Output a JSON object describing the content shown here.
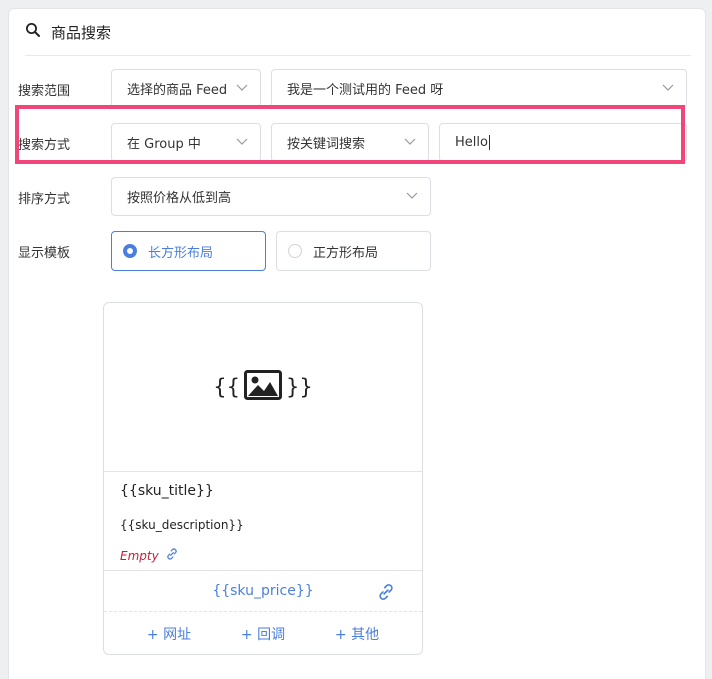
{
  "header": {
    "title": "商品搜索",
    "icon": "search-icon"
  },
  "rows": {
    "scope": {
      "label": "搜索范围",
      "feed_select": "选择的商品 Feed",
      "feed_value": "我是一个测试用的 Feed 呀"
    },
    "method": {
      "label": "搜索方式",
      "group_select": "在 Group 中",
      "mode_select": "按关键词搜索",
      "query_value": "Hello"
    },
    "sort": {
      "label": "排序方式",
      "sort_select": "按照价格从低到高"
    },
    "template": {
      "label": "显示模板",
      "options": [
        {
          "label": "长方形布局",
          "selected": true
        },
        {
          "label": "正方形布局",
          "selected": false
        }
      ]
    }
  },
  "card": {
    "image_open": "{{",
    "image_close": "}}",
    "image_icon": "image-icon",
    "title": "{{sku_title}}",
    "description": "{{sku_description}}",
    "empty_label": "Empty",
    "price": "{{sku_price}}",
    "actions": [
      "+ 网址",
      "+ 回调",
      "+ 其他"
    ]
  },
  "colors": {
    "accent": "#4a7fe0",
    "highlight": "#f0467a",
    "empty": "#c0213b"
  }
}
